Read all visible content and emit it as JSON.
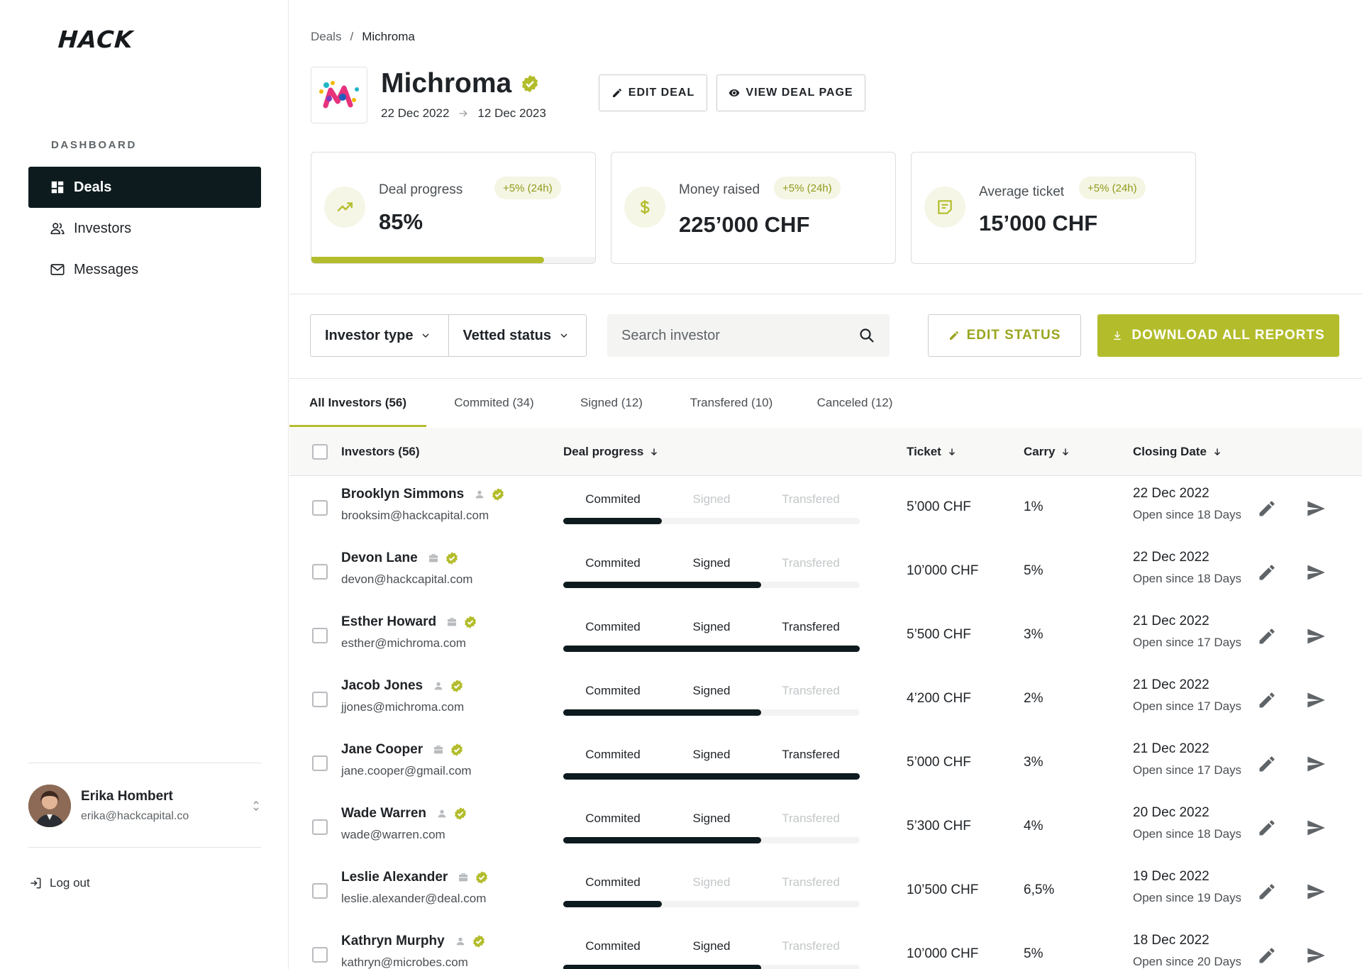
{
  "sidebar": {
    "logo": "HACK",
    "section_label": "DASHBOARD",
    "nav": [
      {
        "label": "Deals",
        "icon": "dashboard-icon",
        "active": true
      },
      {
        "label": "Investors",
        "icon": "people-icon",
        "active": false
      },
      {
        "label": "Messages",
        "icon": "mail-icon",
        "active": false
      }
    ],
    "user": {
      "name": "Erika Hombert",
      "email": "erika@hackcapital.co"
    },
    "logout_label": "Log out"
  },
  "breadcrumb": {
    "root": "Deals",
    "separator": "/",
    "current": "Michroma"
  },
  "deal": {
    "name": "Michroma",
    "start_date": "22 Dec 2022",
    "end_date": "12 Dec 2023",
    "edit_label": "EDIT DEAL",
    "view_label": "VIEW DEAL PAGE"
  },
  "stats": [
    {
      "label": "Deal progress",
      "badge": "+5% (24h)",
      "value": "85%",
      "progress": 0.82,
      "icon": "trending-up-icon"
    },
    {
      "label": "Money raised",
      "badge": "+5% (24h)",
      "value": "225’000 CHF",
      "icon": "dollar-icon"
    },
    {
      "label": "Average ticket",
      "badge": "+5% (24h)",
      "value": "15’000 CHF",
      "icon": "ticket-note-icon"
    }
  ],
  "filters": {
    "investor_type": "Investor type",
    "vetted_status": "Vetted status",
    "search_placeholder": "Search investor",
    "edit_status_label": "EDIT STATUS",
    "download_label": "DOWNLOAD ALL REPORTS"
  },
  "tabs": [
    {
      "label": "All Investors (56)",
      "active": true
    },
    {
      "label": "Commited (34)",
      "active": false
    },
    {
      "label": "Signed (12)",
      "active": false
    },
    {
      "label": "Transfered (10)",
      "active": false
    },
    {
      "label": "Canceled (12)",
      "active": false
    }
  ],
  "table": {
    "headers": {
      "investors": "Investors (56)",
      "deal_progress": "Deal progress",
      "ticket": "Ticket",
      "carry": "Carry",
      "closing_date": "Closing Date"
    },
    "step_labels": [
      "Commited",
      "Signed",
      "Transfered"
    ],
    "rows": [
      {
        "name": "Brooklyn Simmons",
        "type": "person",
        "email": "brooksim@hackcapital.com",
        "stage": 1,
        "ticket": "5’000 CHF",
        "carry": "1%",
        "date": "22 Dec 2022",
        "open": "Open since 18 Days"
      },
      {
        "name": "Devon Lane",
        "type": "company",
        "email": "devon@hackcapital.com",
        "stage": 2,
        "ticket": "10’000 CHF",
        "carry": "5%",
        "date": "22 Dec 2022",
        "open": "Open since 18 Days"
      },
      {
        "name": "Esther Howard",
        "type": "company",
        "email": "esther@michroma.com",
        "stage": 3,
        "ticket": "5’500 CHF",
        "carry": "3%",
        "date": "21 Dec 2022",
        "open": "Open since 17 Days"
      },
      {
        "name": "Jacob Jones",
        "type": "person",
        "email": "jjones@michroma.com",
        "stage": 2,
        "ticket": "4’200 CHF",
        "carry": "2%",
        "date": "21 Dec 2022",
        "open": "Open since 17 Days"
      },
      {
        "name": "Jane Cooper",
        "type": "company",
        "email": "jane.cooper@gmail.com",
        "stage": 3,
        "ticket": "5’000 CHF",
        "carry": "3%",
        "date": "21 Dec 2022",
        "open": "Open since 17 Days"
      },
      {
        "name": "Wade Warren",
        "type": "person",
        "email": "wade@warren.com",
        "stage": 2,
        "ticket": "5’300 CHF",
        "carry": "4%",
        "date": "20 Dec 2022",
        "open": "Open since 18 Days"
      },
      {
        "name": "Leslie Alexander",
        "type": "company",
        "email": "leslie.alexander@deal.com",
        "stage": 1,
        "ticket": "10’500 CHF",
        "carry": "6,5%",
        "date": "19 Dec 2022",
        "open": "Open since 19 Days"
      },
      {
        "name": "Kathryn Murphy",
        "type": "person",
        "email": "kathryn@microbes.com",
        "stage": 2,
        "ticket": "10’000 CHF",
        "carry": "5%",
        "date": "18 Dec 2022",
        "open": "Open since 20 Days"
      }
    ]
  },
  "colors": {
    "accent": "#b3bd2c",
    "dark": "#0e1b1e"
  }
}
